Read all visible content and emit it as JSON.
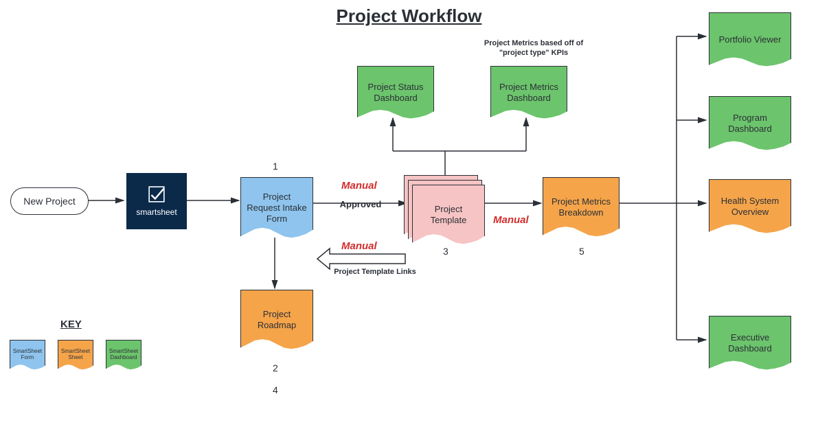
{
  "title": "Project Workflow",
  "nodes": {
    "new_project": "New Project",
    "smartsheet": "smartsheet",
    "intake": "Project Request Intake Form",
    "roadmap": "Project Roadmap",
    "template": "Project Template",
    "status_dash": "Project Status Dashboard",
    "metrics_dash": "Project Metrics Dashboard",
    "metrics_breakdown": "Project Metrics Breakdown",
    "portfolio": "Portfolio Viewer",
    "program": "Program Dashboard",
    "health": "Health System Overview",
    "exec": "Executive Dashboard"
  },
  "edges": {
    "approved": "Approved",
    "template_links": "Project Template Links",
    "manual1": "Manual",
    "manual2": "Manual",
    "manual3": "Manual"
  },
  "annotations": {
    "metrics_note": "Project Metrics based off of \"project type\" KPIs"
  },
  "numbers": {
    "n1": "1",
    "n2": "2",
    "n3": "3",
    "n4": "4",
    "n5": "5"
  },
  "key": {
    "title": "KEY",
    "form": "SmartSheet Form",
    "sheet": "SmartSheet Sheet",
    "dashboard": "SmartSheet Dashboard"
  },
  "colors": {
    "blue": "#8ec4ed",
    "orange": "#f5a44a",
    "green": "#6cc46c",
    "pink": "#f6c4c4",
    "smartsheet_bg": "#0b2a4a",
    "manual_text": "#d22d2d"
  }
}
